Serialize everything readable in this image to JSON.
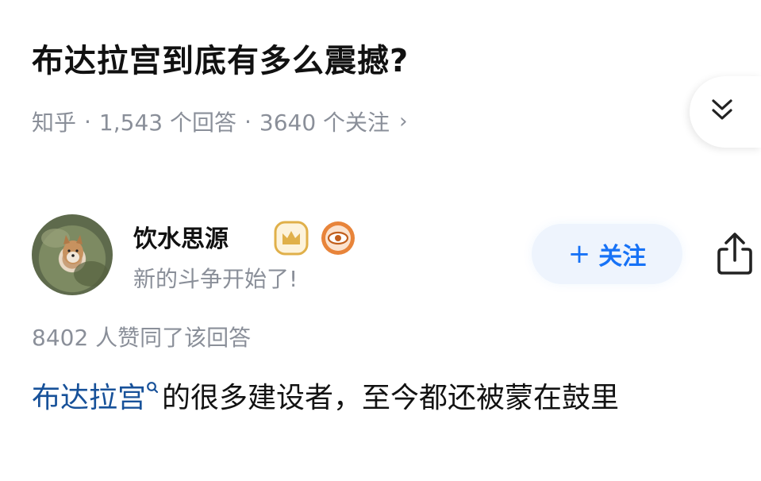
{
  "question": {
    "title": "布达拉宫到底有多么震撼?",
    "source": "知乎",
    "separator": "·",
    "answer_count": "1,543 个回答",
    "follower_count": "3640 个关注",
    "chevron": "›"
  },
  "expand_icon": "double-chevron-down-icon",
  "author": {
    "name": "饮水思源",
    "bio": "新的斗争开始了!",
    "badges": [
      "crown-badge-icon",
      "eye-badge-icon"
    ],
    "follow_label": "关注",
    "follow_plus": "+"
  },
  "answer": {
    "votes": "8402 人赞同了该回答",
    "link_text": "布达拉宫",
    "body_text": "的很多建设者，至今都还被蒙在鼓里"
  },
  "colors": {
    "accent": "#1772f6",
    "link": "#175199",
    "meta": "#8a8f99",
    "badge_gold": "#e0b04a",
    "badge_orange": "#e8843a"
  }
}
